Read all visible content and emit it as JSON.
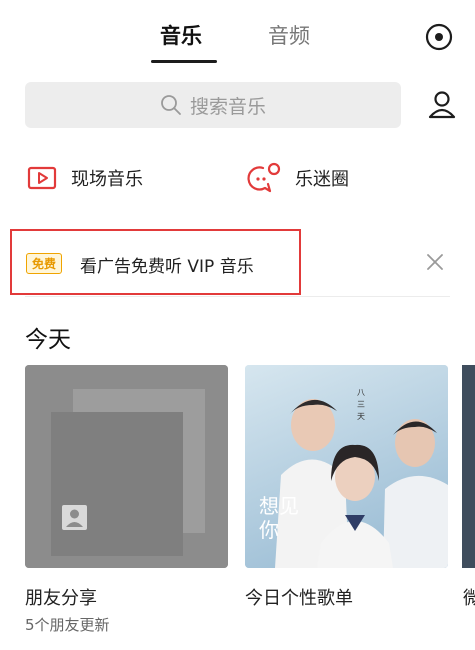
{
  "tabs": [
    {
      "label": "音乐",
      "active": true
    },
    {
      "label": "音频",
      "active": false
    }
  ],
  "search": {
    "placeholder": "搜索音乐"
  },
  "entries": {
    "live": "现场音乐",
    "fans": "乐迷圈"
  },
  "ad": {
    "badge": "免费",
    "text": "看广告免费听 VIP 音乐"
  },
  "section": {
    "title": "今天"
  },
  "cards": [
    {
      "title": "朋友分享",
      "subtitle": "5个朋友更新"
    },
    {
      "title": "今日个性歌单",
      "subtitle": ""
    },
    {
      "title": "微",
      "subtitle": ""
    }
  ],
  "album_art_text": {
    "line1": "想见",
    "line2": "你"
  },
  "colors": {
    "accent_red": "#e23a3a",
    "badge_gold": "#f0a400",
    "search_bg": "#ededed"
  }
}
